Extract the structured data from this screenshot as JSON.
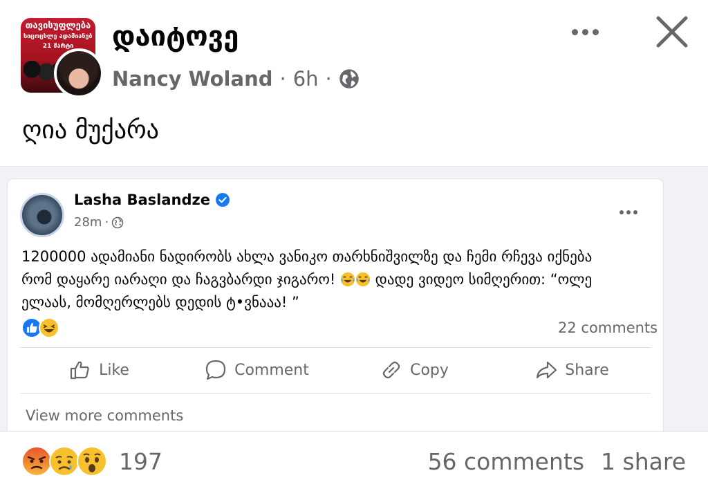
{
  "post": {
    "group_name": "დაიტოვე",
    "author": "Nancy Woland",
    "time": "6h",
    "separator": "·",
    "text": "ღია მუქარა",
    "group_image_text": [
      "თავისუფლება",
      "სიცოცხლე ადამიანებს",
      "21 მარტი"
    ]
  },
  "shared": {
    "author": "Lasha Baslandze",
    "time": "28m",
    "separator": "·",
    "text_lines": [
      "1200000 ადამიანი ნადირობს ახლა ვანიკო თარხნიშვილზე და ჩემი რჩევა იქნება",
      "რომ დაყარე იარაღი და ჩაგვბარდი ჯიგარო!",
      "დადე ვიდეო სიმღერით: “ოლე",
      "ელაას, მომღერლებს დედის ტ•ვნააა! ”"
    ],
    "comments_count": "22 comments",
    "actions": {
      "like": "Like",
      "comment": "Comment",
      "copy": "Copy",
      "share": "Share"
    },
    "view_more": "View more comments"
  },
  "footer": {
    "reaction_count": "197",
    "comments": "56 comments",
    "shares": "1 share"
  },
  "icons": [
    "globe-icon",
    "more-icon",
    "close-icon",
    "verified-icon",
    "like-icon",
    "comment-icon",
    "copy-icon",
    "share-icon",
    "like-reaction-icon",
    "haha-reaction-icon",
    "angry-reaction-icon",
    "sad-reaction-icon",
    "wow-reaction-icon"
  ],
  "colors": {
    "accent": "#1877f2",
    "secondary_text": "#65676b",
    "background_gray": "#f0f2f5"
  }
}
